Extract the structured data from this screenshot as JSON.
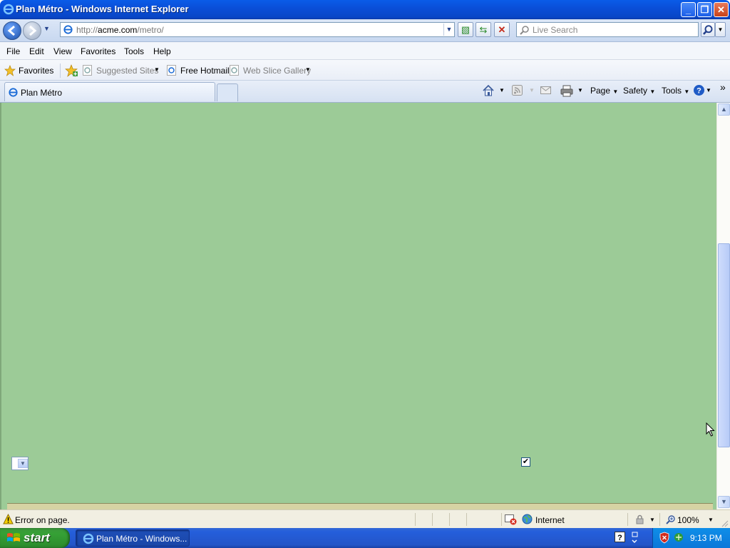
{
  "window": {
    "title": "Plan Métro - Windows Internet Explorer"
  },
  "address": {
    "url_prefix": "http://",
    "url_domain": "acme.com",
    "url_path": "/metro/"
  },
  "search": {
    "placeholder": "Live Search"
  },
  "menu": [
    "File",
    "Edit",
    "View",
    "Favorites",
    "Tools",
    "Help"
  ],
  "favorites_bar": {
    "favorites_label": "Favorites",
    "items": [
      {
        "label": "Suggested Sites",
        "enabled": false
      },
      {
        "label": "Free Hotmail",
        "enabled": true
      },
      {
        "label": "Web Slice Gallery",
        "enabled": false
      }
    ]
  },
  "tab": {
    "label": "Plan Métro"
  },
  "command_bar": {
    "page": "Page",
    "safety": "Safety",
    "tools": "Tools",
    "overflow": "»"
  },
  "content": {
    "checkbox_checked": true,
    "background_color": "#9ccb97"
  },
  "status": {
    "message": "Error on page.",
    "zone": "Internet",
    "zoom": "100%"
  },
  "taskbar": {
    "start_label": "start",
    "window_item": "Plan Métro - Windows...",
    "clock": "9:13 PM"
  },
  "colors": {
    "titlebar": "#0a4fd9",
    "taskbar": "#245edb",
    "start": "#35a035"
  }
}
